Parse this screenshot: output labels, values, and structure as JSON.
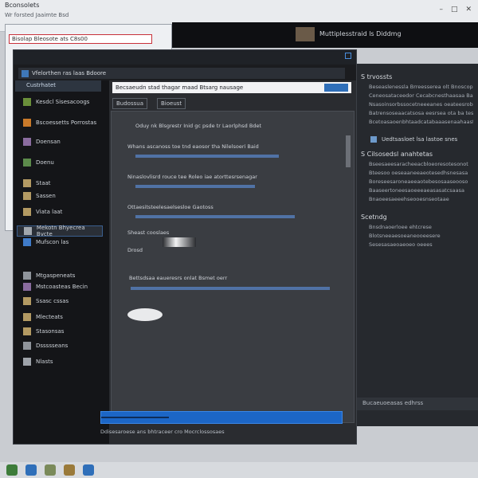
{
  "colors": {
    "accent": "#1c66c6",
    "panel_dark": "#1b1c1f",
    "nav_selected": "#3b5f8f"
  },
  "background_window": {
    "title": "Bconsolets",
    "subtitle": "Wr forsted Jaaimte Bsd"
  },
  "explorer_back": {
    "address": "Bisolap Bleosote ats C8s00"
  },
  "media_window": {
    "title": "Muttiplesstraid ls Diddmg"
  },
  "main_window": {
    "address": "Vfelorthen ras laas Bdoore",
    "nav_header": "Custrhatet",
    "nav_items": [
      {
        "label": "Kesdcl Sisesacoogs",
        "icon": "app-icon"
      },
      {
        "label": "Bscoessetts Porrostas",
        "icon": "folder-icon"
      },
      {
        "label": "Doensan",
        "icon": "image-icon"
      },
      {
        "label": "Doenu",
        "icon": "photo-icon"
      },
      {
        "label": "Staat",
        "icon": "box-icon"
      },
      {
        "label": "Sassen",
        "icon": "box-icon"
      },
      {
        "label": "Viata laat",
        "icon": "box-icon"
      },
      {
        "label": "Mekotn Bhyecrea Bvcte",
        "icon": "link-icon"
      },
      {
        "label": "Mufscon las",
        "icon": "badge-icon"
      },
      {
        "label": "Mtgaspeneats",
        "icon": "gear-icon"
      },
      {
        "label": "Mstcoasteas Becin",
        "icon": "image-icon"
      },
      {
        "label": "Ssasc cssas",
        "icon": "box-icon"
      },
      {
        "label": "Mlecteats",
        "icon": "box-icon"
      },
      {
        "label": "Stasonsas",
        "icon": "box-icon"
      },
      {
        "label": "Dssssseans",
        "icon": "gear-icon"
      },
      {
        "label": "Nlasts",
        "icon": "home-icon"
      }
    ],
    "search_value": "Becsaeudn stad thagar maad Btsarg nausage",
    "tabs": [
      "Budossua",
      "Bioeust"
    ],
    "pane_lines": [
      "Oduy nk Blsgrestr Inid gc psde tr Laorlphsd Bdet",
      "Whans ascanoss toe tnd eaosor tha Nilelsoeri Baid",
      "Ninaslovlisrd rouce tee Roleo iae atorttesrsenagar",
      "Ottaesitsteelesaelsesloe Gaotoss",
      "Sheast cooslaes",
      "Drosd",
      "Bettsdsaa eaueresrs onlat Bsmet oerr"
    ],
    "progress_percent": 28,
    "status_text": "Ddisesaroese ans bhtraceer cro Mocrclossosaes"
  },
  "right_panel": {
    "heading1": "S trvossts",
    "lines1": [
      "Beseaslenessla Brreesserea olt Bnoscopessosteatsest",
      "Ceneosataceedor Cecabcnesthaasaa Batt",
      "Nsasoinsorbssocetneeeanes oeateesrobentlesas",
      "Batrensoseaacatsosa eesrsea ota ba tesaaat",
      "Bcetoasaoenbhtaadcatabaaasenaahaastoagaase"
    ],
    "box_label": "Uedtsasloet lsa lastoe snes",
    "heading2": "S Cilsosedsl anahtetas",
    "lines2": [
      "Bseesaeesaracheeacbloeoresotesonot",
      "Bteesoo oeseaaneeaeotesedhsnesasa",
      "Boreseesaroneaeeaotebesosaaseooso",
      "Baaseertoneesaoeeeaeasasatcsaasa",
      "Bnaoeesaeeehseooesnseotaae"
    ],
    "heading3": "Scetndg",
    "lines3": [
      "Bnsdnaoerloee ehtcrese",
      "Blotsneeaesoeaneooeesere",
      "Sesesasaeoaeoeo oeees"
    ],
    "footer": "Bucaeuoeasas edhrss"
  },
  "taskbar": {
    "icons": [
      "globe-icon",
      "folder-icon",
      "chart-icon",
      "media-icon",
      "settings-icon"
    ]
  }
}
